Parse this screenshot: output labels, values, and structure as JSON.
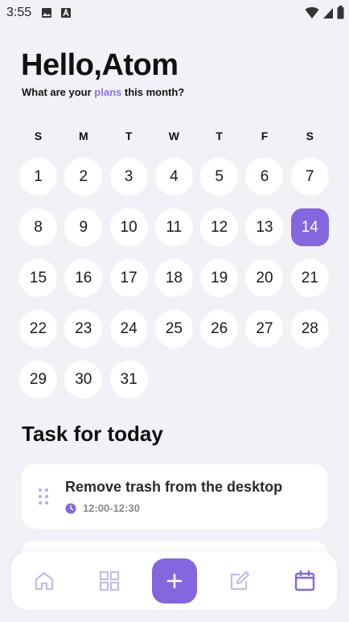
{
  "status_bar": {
    "time": "3:55"
  },
  "header": {
    "greeting": "Hello,Atom",
    "subtitle_before": "What are your ",
    "subtitle_accent": "plans",
    "subtitle_after": " this month?"
  },
  "calendar": {
    "weekdays": [
      "S",
      "M",
      "T",
      "W",
      "T",
      "F",
      "S"
    ],
    "days": [
      "1",
      "2",
      "3",
      "4",
      "5",
      "6",
      "7",
      "8",
      "9",
      "10",
      "11",
      "12",
      "13",
      "14",
      "15",
      "16",
      "17",
      "18",
      "19",
      "20",
      "21",
      "22",
      "23",
      "24",
      "25",
      "26",
      "27",
      "28",
      "29",
      "30",
      "31"
    ],
    "selected_day": "14"
  },
  "tasks": {
    "section_title": "Task for today",
    "items": [
      {
        "title": "Remove trash from the desktop",
        "time": "12:00-12:30"
      }
    ]
  },
  "nav": {
    "items": [
      "home-icon",
      "grid-icon",
      "add-icon",
      "edit-icon",
      "calendar-icon"
    ],
    "accent": "#8466df"
  },
  "colors": {
    "accent": "#8466df",
    "background": "#f3f1f8",
    "card": "#ffffff"
  }
}
